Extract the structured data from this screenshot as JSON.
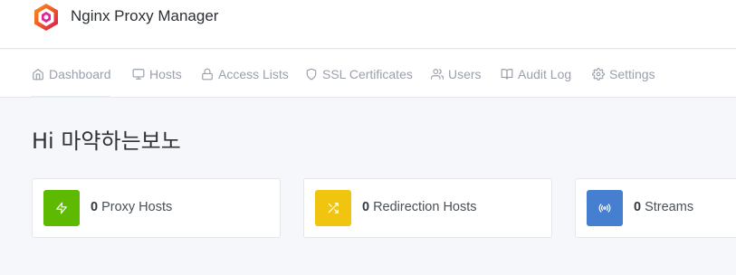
{
  "app": {
    "title": "Nginx Proxy Manager"
  },
  "nav": {
    "items": [
      {
        "label": "Dashboard",
        "icon": "home-icon"
      },
      {
        "label": "Hosts",
        "icon": "monitor-icon"
      },
      {
        "label": "Access Lists",
        "icon": "lock-icon"
      },
      {
        "label": "SSL Certificates",
        "icon": "shield-icon"
      },
      {
        "label": "Users",
        "icon": "users-icon"
      },
      {
        "label": "Audit Log",
        "icon": "book-icon"
      },
      {
        "label": "Settings",
        "icon": "gear-icon"
      }
    ]
  },
  "greeting": "Hi 마약하는보노",
  "stats": [
    {
      "count": "0",
      "label": "Proxy Hosts",
      "icon": "zap-icon",
      "color": "#5eba00"
    },
    {
      "count": "0",
      "label": "Redirection Hosts",
      "icon": "shuffle-icon",
      "color": "#f1c40f"
    },
    {
      "count": "0",
      "label": "Streams",
      "icon": "radio-icon",
      "color": "#467fcf"
    }
  ],
  "colors": {
    "nav_text": "#9aa0ac",
    "page_bg": "#f5f7fb",
    "logo_orange": "#f15a24",
    "logo_pink": "#e0249a"
  }
}
